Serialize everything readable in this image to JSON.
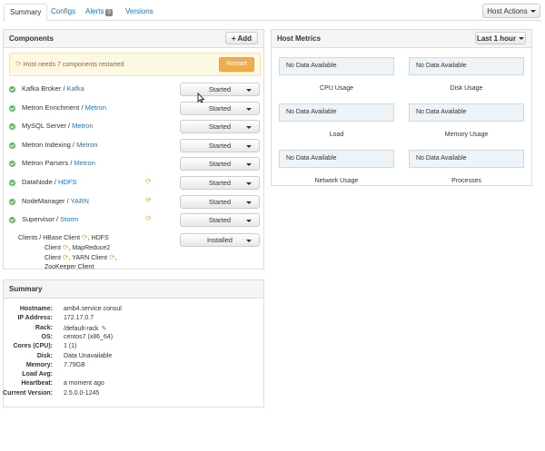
{
  "tabs": {
    "summary": "Summary",
    "configs": "Configs",
    "alerts": "Alerts",
    "alerts_count": "0",
    "versions": "Versions"
  },
  "host_actions_label": "Host Actions",
  "components": {
    "title": "Components",
    "add_label": "+ Add",
    "alert_text": "Host needs 7 components restarted",
    "restart_label": "Restart",
    "rows": [
      {
        "name": "Kafka Broker",
        "sep": " / ",
        "service": "Kafka",
        "state": "Started",
        "restart": false
      },
      {
        "name": "Metron Enrichment",
        "sep": " / ",
        "service": "Metron",
        "state": "Started",
        "restart": false
      },
      {
        "name": "MySQL Server",
        "sep": " / ",
        "service": "Metron",
        "state": "Started",
        "restart": false
      },
      {
        "name": "Metron Indexing",
        "sep": " / ",
        "service": "Metron",
        "state": "Started",
        "restart": false
      },
      {
        "name": "Metron Parsers",
        "sep": " / ",
        "service": "Metron",
        "state": "Started",
        "restart": false
      },
      {
        "name": "DataNode",
        "sep": " / ",
        "service": "HDFS",
        "state": "Started",
        "restart": true
      },
      {
        "name": "NodeManager",
        "sep": " / ",
        "service": "YARN",
        "state": "Started",
        "restart": true
      },
      {
        "name": "Supervisor",
        "sep": " / ",
        "service": "Storm",
        "state": "Started",
        "restart": true
      }
    ],
    "clients": {
      "prefix": "Clients / HBase Client",
      "l1b": ", HDFS",
      "l2a": "Client",
      "l2b": ", MapReduce2",
      "l3a": "Client",
      "l3b": ", YARN Client",
      "l3c": ",",
      "l4": "ZooKeeper Client",
      "state": "Installed"
    }
  },
  "metrics": {
    "title": "Host Metrics",
    "range_label": "Last 1 hour",
    "no_data": "No Data Available",
    "labels": {
      "cpu": "CPU Usage",
      "disk": "Disk Usage",
      "load": "Load",
      "memory": "Memory Usage",
      "network": "Network Usage",
      "processes": "Processes"
    }
  },
  "summary": {
    "title": "Summary",
    "rows": [
      {
        "key": "Hostname:",
        "value": "amb4.service.consul"
      },
      {
        "key": "IP Address:",
        "value": "172.17.0.7"
      },
      {
        "key": "Rack:",
        "value": "/default-rack"
      },
      {
        "key": "OS:",
        "value": "centos7 (x86_64)"
      },
      {
        "key": "Cores (CPU):",
        "value": "1 (1)"
      },
      {
        "key": "Disk:",
        "value": "Data Unavailable"
      },
      {
        "key": "Memory:",
        "value": "7.79GB"
      },
      {
        "key": "Load Avg:",
        "value": ""
      },
      {
        "key": "Heartbeat:",
        "value": "a moment ago"
      },
      {
        "key": "Current Version:",
        "value": "2.5.0.0-1245"
      }
    ]
  },
  "colors": {
    "link": "#1a74c4",
    "started_green": "#5cb85c",
    "warning_orange": "#f0ad4e",
    "alert_bg": "#fcf8e3",
    "metric_bg": "#eef3f7"
  }
}
